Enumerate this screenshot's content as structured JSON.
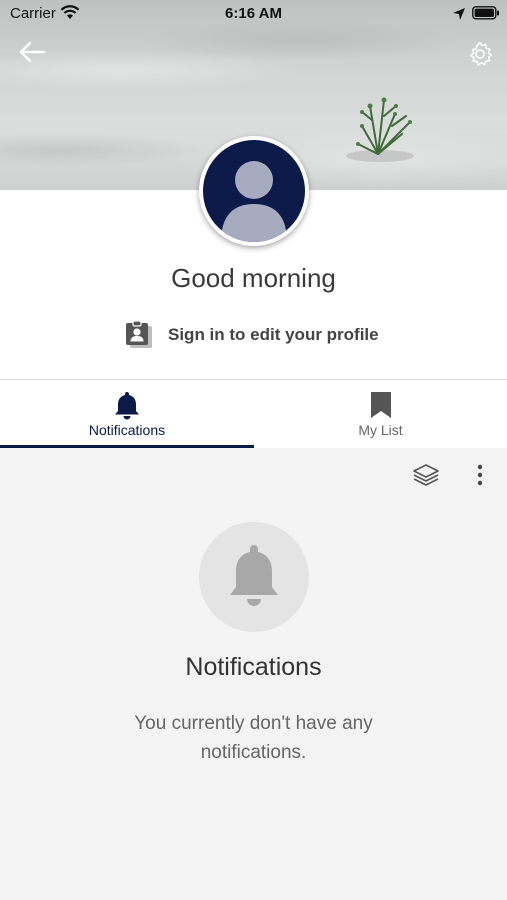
{
  "status_bar": {
    "carrier": "Carrier",
    "time": "6:16 AM"
  },
  "header": {
    "back_icon": "arrow-left-icon",
    "settings_icon": "gear-icon"
  },
  "profile": {
    "greeting": "Good morning",
    "signin_label": "Sign in to edit your profile"
  },
  "tabs": [
    {
      "label": "Notifications",
      "icon": "bell-icon",
      "selected": true
    },
    {
      "label": "My List",
      "icon": "bookmark-icon",
      "selected": false
    }
  ],
  "toolbar": {
    "layers_icon": "layers-icon",
    "more_icon": "more-vertical-icon"
  },
  "empty_state": {
    "title": "Notifications",
    "message": "You currently don't have any notifications."
  },
  "colors": {
    "accent": "#0c1a4a",
    "background": "#f4f4f4"
  }
}
